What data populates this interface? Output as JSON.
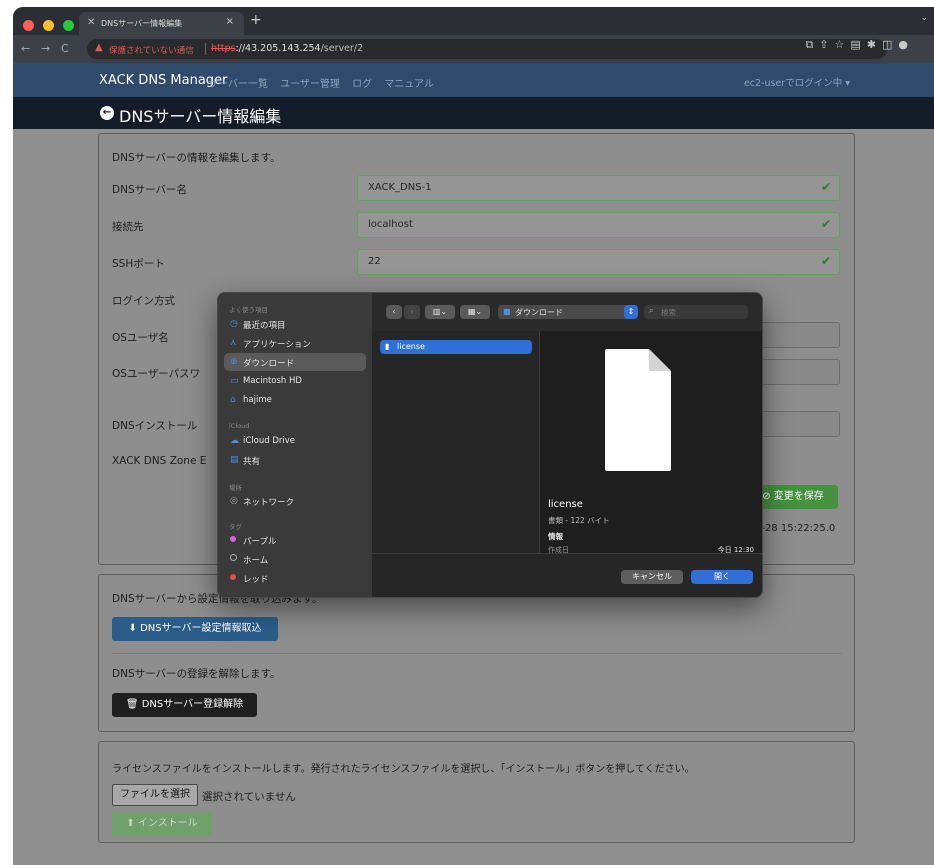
{
  "browser": {
    "tab_title": "DNSサーバー情報編集",
    "url_warning": "保護されていない通信",
    "url_scheme": "https",
    "url_host": "://43.205.143.254",
    "url_path": "/server/2"
  },
  "app": {
    "brand": "XACK DNS Manager",
    "nav": [
      "サーバー一覧",
      "ユーザー管理",
      "ログ",
      "マニュアル"
    ],
    "user_menu": "ec2-userでログイン中 ▾",
    "page_title": "DNSサーバー情報編集"
  },
  "form": {
    "intro": "DNSサーバーの情報を編集します。",
    "name_label": "DNSサーバー名",
    "name_value": "XACK_DNS-1",
    "host_label": "接続先",
    "host_value": "localhost",
    "ssh_label": "SSHポート",
    "ssh_value": "22",
    "login_label": "ログイン方式",
    "os_user_label": "OSユーザ名",
    "os_pass_label": "OSユーザーパスワ",
    "dns_install_label": "DNSインストール",
    "zone_label": "XACK DNS Zone E",
    "save_label": "変更を保存",
    "updated_text": "-09-28 15:22:25.0"
  },
  "import_panel": {
    "text": "DNSサーバーから設定情報を取り込みます。",
    "button": "DNSサーバー設定情報取込",
    "unregister_text": "DNSサーバーの登録を解除します。",
    "unregister_button": "DNSサーバー登録解除"
  },
  "license_panel": {
    "text": "ライセンスファイルをインストールします。発行されたライセンスファイルを選択し、「インストール」ボタンを押してください。",
    "choose_button": "ファイルを選択",
    "no_file": "選択されていません",
    "install_button": "インストール"
  },
  "dialog": {
    "sections": {
      "favorites": "よく使う項目",
      "icloud": "iCloud",
      "locations": "場所",
      "tags": "タグ"
    },
    "favorites": [
      {
        "icon": "◷",
        "label": "最近の項目"
      },
      {
        "icon": "⋏",
        "label": "アプリケーション"
      },
      {
        "icon": "⊕",
        "label": "ダウンロード"
      },
      {
        "icon": "▭",
        "label": "Macintosh HD"
      },
      {
        "icon": "⌂",
        "label": "hajime"
      }
    ],
    "icloud": [
      {
        "icon": "☁",
        "label": "iCloud Drive"
      },
      {
        "icon": "▤",
        "label": "共有"
      }
    ],
    "locations": [
      {
        "icon": "◎",
        "label": "ネットワーク"
      }
    ],
    "tags": [
      {
        "color": "#d463e0",
        "label": "パープル"
      },
      {
        "color": "transparent",
        "label": "ホーム"
      },
      {
        "color": "#e8504a",
        "label": "レッド"
      }
    ],
    "location": "ダウンロード",
    "search_placeholder": "検索",
    "file": "license",
    "preview": {
      "name": "license",
      "kind": "書類 - 122 バイト",
      "info": "情報",
      "created_label": "作成日",
      "created_value": "今日 12:30"
    },
    "cancel": "キャンセル",
    "open": "開く"
  }
}
